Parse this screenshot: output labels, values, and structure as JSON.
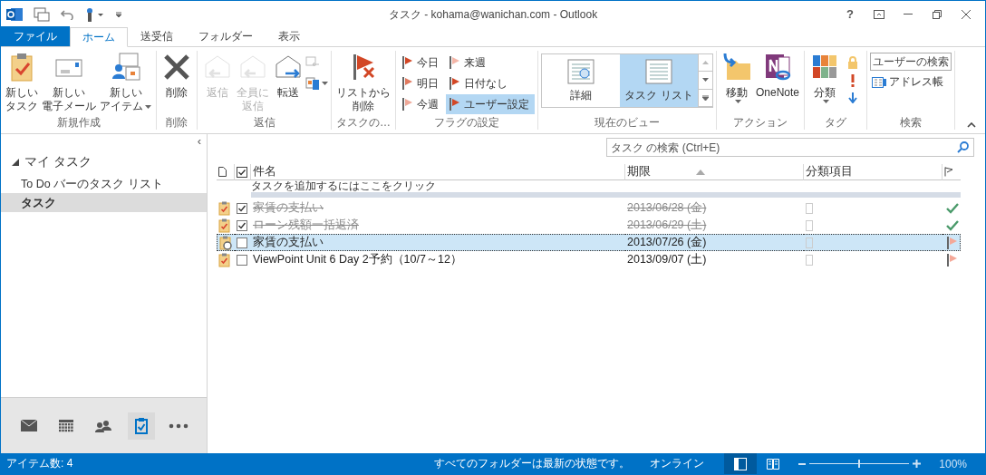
{
  "window": {
    "title": "タスク - kohama@wanichan.com - Outlook",
    "help": "?"
  },
  "tabs": [
    {
      "label": "ファイル",
      "kind": "file",
      "selected": false
    },
    {
      "label": "ホーム",
      "kind": "tab",
      "selected": true
    },
    {
      "label": "送受信",
      "kind": "tab",
      "selected": false
    },
    {
      "label": "フォルダー",
      "kind": "tab",
      "selected": false
    },
    {
      "label": "表示",
      "kind": "tab",
      "selected": false
    }
  ],
  "ribbon": {
    "groups": [
      {
        "label": "新規作成",
        "items": [
          {
            "kind": "large",
            "lines": [
              "新しい",
              "タスク"
            ],
            "disabled": false,
            "dropdown": false
          },
          {
            "kind": "large",
            "lines": [
              "新しい",
              "電子メール"
            ],
            "disabled": false,
            "dropdown": false
          },
          {
            "kind": "large",
            "lines": [
              "新しい",
              "アイテム"
            ],
            "disabled": false,
            "dropdown": true
          }
        ]
      },
      {
        "label": "削除",
        "items": [
          {
            "kind": "large",
            "lines": [
              "削除"
            ],
            "disabled": false,
            "dropdown": false
          }
        ]
      },
      {
        "label": "返信",
        "items": [
          {
            "kind": "large",
            "lines": [
              "返信"
            ],
            "disabled": true,
            "dropdown": false
          },
          {
            "kind": "large",
            "lines": [
              "全員に",
              "返信"
            ],
            "disabled": true,
            "dropdown": false
          },
          {
            "kind": "large",
            "lines": [
              "転送"
            ],
            "disabled": false,
            "dropdown": false
          },
          {
            "kind": "iconstack"
          }
        ]
      },
      {
        "label": "タスクの…",
        "items": [
          {
            "kind": "large",
            "lines": [
              "リストから",
              "削除"
            ],
            "disabled": false,
            "dropdown": false
          }
        ]
      },
      {
        "label": "フラグの設定",
        "items": [
          {
            "kind": "flags",
            "flags": [
              {
                "label": "今日",
                "color": "#d24726",
                "selected": false
              },
              {
                "label": "来週",
                "color": "#f4b6a8",
                "selected": false
              },
              {
                "label": "明日",
                "color": "#e07a5f",
                "selected": false
              },
              {
                "label": "日付なし",
                "color": "#d24726",
                "selected": false
              },
              {
                "label": "今週",
                "color": "#eea898",
                "selected": false
              },
              {
                "label": "ユーザー設定",
                "color": "#d24726",
                "selected": true
              }
            ]
          }
        ]
      },
      {
        "label": "現在のビュー",
        "items": [
          {
            "kind": "gallery",
            "views": [
              {
                "label": "詳細",
                "selected": false
              },
              {
                "label": "タスク リスト",
                "selected": true
              }
            ]
          }
        ]
      },
      {
        "label": "アクション",
        "items": [
          {
            "kind": "large",
            "lines": [
              "移動"
            ],
            "disabled": false,
            "dropdown": true
          },
          {
            "kind": "large",
            "lines": [
              "OneNote"
            ],
            "disabled": false,
            "dropdown": false
          }
        ]
      },
      {
        "label": "タグ",
        "items": [
          {
            "kind": "large",
            "lines": [
              "分類"
            ],
            "disabled": false,
            "dropdown": true
          },
          {
            "kind": "tagicons"
          }
        ]
      },
      {
        "label": "検索",
        "items": [
          {
            "kind": "search",
            "placeholder": "ユーザーの検索",
            "link": "アドレス帳"
          }
        ]
      }
    ]
  },
  "sidebar": {
    "collapse": "‹",
    "header": "マイ タスク",
    "expanded": true,
    "items": [
      {
        "label": "To Do バーのタスク リスト",
        "selected": false
      },
      {
        "label": "タスク",
        "selected": true
      }
    ],
    "nav": [
      {
        "selected": false
      },
      {
        "selected": false
      },
      {
        "selected": false
      },
      {
        "selected": true
      },
      {
        "selected": false
      }
    ]
  },
  "task_list": {
    "search": {
      "placeholder": "タスク の検索 (Ctrl+E)"
    },
    "columns": [
      {
        "label": "件名",
        "sorted": false
      },
      {
        "label": "期限",
        "sorted": true
      },
      {
        "label": "分類項目",
        "sorted": false
      }
    ],
    "add_row": "タスクを追加するにはここをクリック",
    "rows": [
      {
        "subject": "家賃の支払い",
        "due": "2013/06/28 (金)",
        "checked": true,
        "selected": false,
        "recurring": false
      },
      {
        "subject": "ローン残額一括返済",
        "due": "2013/06/29 (土)",
        "checked": true,
        "selected": false,
        "recurring": false
      },
      {
        "subject": "家賃の支払い",
        "due": "2013/07/26 (金)",
        "checked": false,
        "selected": true,
        "recurring": true
      },
      {
        "subject": "ViewPoint Unit 6 Day 2予約（10/7～12）",
        "due": "2013/09/07 (土)",
        "checked": false,
        "selected": false,
        "recurring": false
      }
    ]
  },
  "status_bar": {
    "count": "アイテム数: 4",
    "sync": "すべてのフォルダーは最新の状態です。",
    "connection": "オンライン",
    "zoom": {
      "level": 0.5,
      "label": "100%"
    }
  }
}
